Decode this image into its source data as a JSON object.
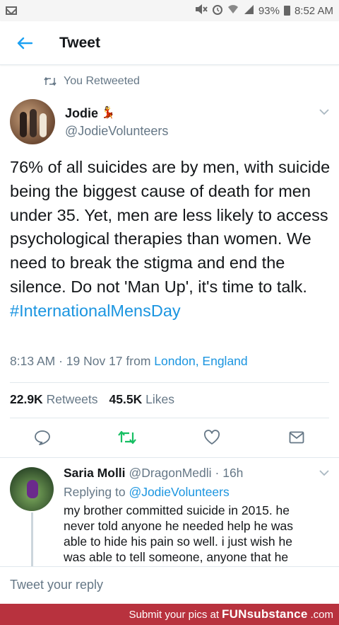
{
  "status_bar": {
    "battery": "93%",
    "time": "8:52 AM",
    "left_icon": "gmail-icon",
    "right_icons": [
      "mute-icon",
      "alarm-icon",
      "wifi-icon",
      "signal-icon",
      "battery-icon"
    ]
  },
  "app_bar": {
    "title": "Tweet",
    "back_icon": "back-arrow-icon"
  },
  "tweet": {
    "retweet_context": "You Retweeted",
    "author_name": "Jodie",
    "author_handle": "@JodieVolunteers",
    "text": "76% of all suicides are by men, with suicide being the biggest cause of death for men under 35. Yet, men are less likely to access psychological therapies than women. We need to break the stigma and end the silence. Do not 'Man Up', it's time to talk.",
    "hashtag": "#InternationalMensDay",
    "timestamp": "8:13 AM · 19 Nov 17",
    "from_label": "from",
    "location": "London, England",
    "retweets_count": "22.9K",
    "retweets_label": "Retweets",
    "likes_count": "45.5K",
    "likes_label": "Likes"
  },
  "reply": {
    "author_name": "Saria Molli",
    "author_handle": "@DragonMedli",
    "time": "· 16h",
    "replying_label": "Replying to",
    "replying_to": "@JodieVolunteers",
    "text": "my brother committed suicide in 2015. he never told anyone he needed help he was able to hide his pain so well. i just wish he was able to tell someone, anyone that he"
  },
  "compose": {
    "placeholder": "Tweet your reply"
  },
  "watermark": {
    "text": "Submit your pics at",
    "brand": "FUNsubstance",
    "suffix": ".com"
  },
  "colors": {
    "accent": "#1da1f2",
    "link": "#1b95e0",
    "retweet_green": "#17bf63",
    "muted": "#657786",
    "watermark_bg": "#b8323e"
  }
}
